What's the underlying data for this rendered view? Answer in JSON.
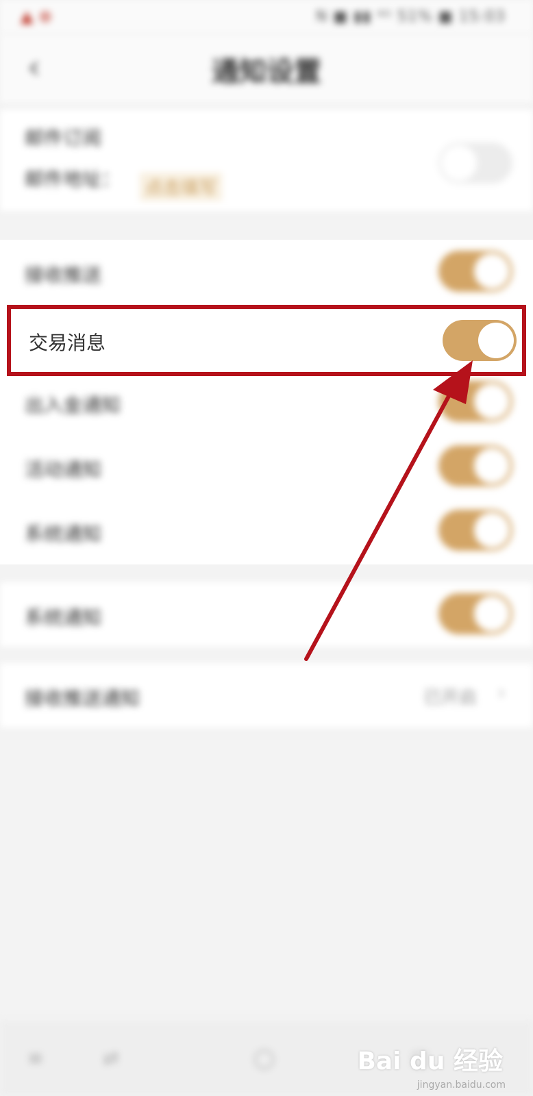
{
  "status_bar": {
    "left_text": "▲ ⊕",
    "right_text": "N ■ ▮▮ ⁴ᴳ 51% ■ 15:03"
  },
  "header": {
    "back_icon": "back-arrow-icon",
    "title": "通知设置"
  },
  "email": {
    "label": "邮件订阅",
    "address_label": "邮件地址：",
    "address_note": "点击填写",
    "toggle_on": false
  },
  "settings": [
    {
      "label": "接收推送",
      "toggle_on": true
    },
    {
      "label": "交易消息",
      "toggle_on": true
    },
    {
      "label": "出入金通知",
      "toggle_on": true
    },
    {
      "label": "活动通知",
      "toggle_on": true
    },
    {
      "label": "系统通知",
      "toggle_on": true
    }
  ],
  "other": {
    "label": "系统通知",
    "toggle_on": true
  },
  "bottom_row": {
    "label": "接收推送通知",
    "value": "已开启",
    "chevron": "›"
  },
  "bottom_nav": [
    "≡",
    "⇄",
    "◯",
    "▢"
  ],
  "watermark": {
    "main": "Bai du 经验",
    "sub": "jingyan.baidu.com"
  },
  "colors": {
    "accent": "#d3a566",
    "highlight_border": "#b5121b",
    "arrow": "#b5121b",
    "background": "#f3f3f3"
  }
}
